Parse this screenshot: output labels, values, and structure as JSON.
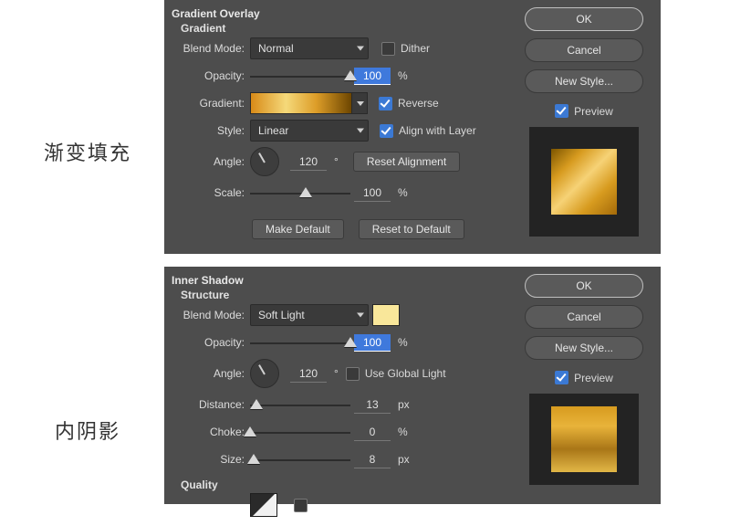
{
  "panel1": {
    "title": "Gradient Overlay",
    "subtitle": "Gradient",
    "blend_mode_label": "Blend Mode:",
    "blend_mode_value": "Normal",
    "dither_label": "Dither",
    "opacity_label": "Opacity:",
    "opacity_value": "100",
    "opacity_unit": "%",
    "gradient_label": "Gradient:",
    "reverse_label": "Reverse",
    "style_label": "Style:",
    "style_value": "Linear",
    "align_label": "Align with Layer",
    "angle_label": "Angle:",
    "angle_value": "120",
    "angle_unit": "°",
    "reset_alignment": "Reset Alignment",
    "scale_label": "Scale:",
    "scale_value": "100",
    "scale_unit": "%",
    "make_default": "Make Default",
    "reset_default": "Reset to Default"
  },
  "panel2": {
    "title": "Inner Shadow",
    "subtitle": "Structure",
    "blend_mode_label": "Blend Mode:",
    "blend_mode_value": "Soft Light",
    "opacity_label": "Opacity:",
    "opacity_value": "100",
    "opacity_unit": "%",
    "angle_label": "Angle:",
    "angle_value": "120",
    "angle_unit": "°",
    "global_light_label": "Use Global Light",
    "distance_label": "Distance:",
    "distance_value": "13",
    "distance_unit": "px",
    "choke_label": "Choke:",
    "choke_value": "0",
    "choke_unit": "%",
    "size_label": "Size:",
    "size_value": "8",
    "size_unit": "px",
    "quality_label": "Quality"
  },
  "right": {
    "ok": "OK",
    "cancel": "Cancel",
    "new_style": "New Style...",
    "preview": "Preview"
  },
  "labels": {
    "gradient_fill_cn": "渐变填充",
    "inner_shadow_cn": "内阴影"
  }
}
